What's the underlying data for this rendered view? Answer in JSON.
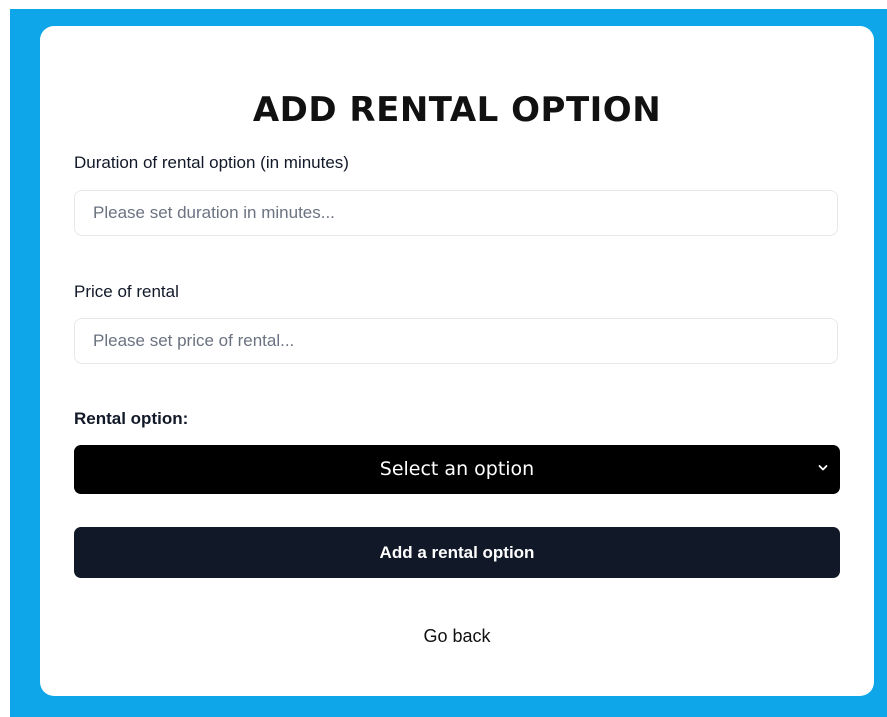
{
  "form": {
    "title": "ADD RENTAL OPTION",
    "duration": {
      "label": "Duration of rental option (in minutes)",
      "placeholder": "Please set duration in minutes...",
      "value": ""
    },
    "price": {
      "label": "Price of rental",
      "placeholder": "Please set price of rental...",
      "value": ""
    },
    "rental_option": {
      "label": "Rental option:",
      "selected": "Select an option"
    },
    "submit_label": "Add a rental option",
    "back_label": "Go back"
  },
  "colors": {
    "background": "#0ea5e9",
    "card": "#ffffff",
    "select_bg": "#000000",
    "button_bg": "#111827"
  },
  "icons": {
    "select_arrow": "chevron-down-icon"
  }
}
